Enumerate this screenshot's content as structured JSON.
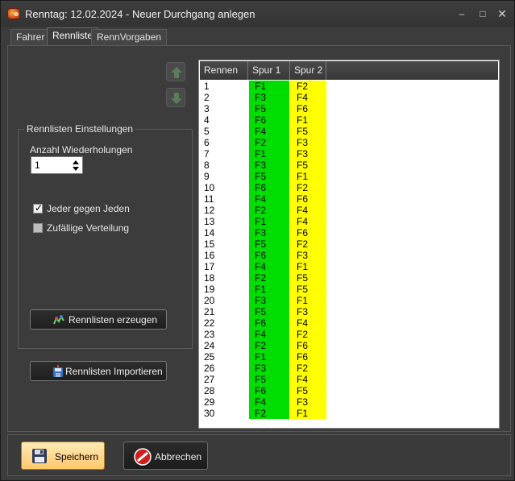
{
  "window": {
    "title": "Renntag: 12.02.2024 - Neuer Durchgang anlegen",
    "controls": {
      "minimize": "–",
      "maximize": "□",
      "close": "✕"
    }
  },
  "tabs": [
    {
      "label": "Fahrer",
      "active": false
    },
    {
      "label": "Rennliste",
      "active": true
    },
    {
      "label": "RennVorgaben",
      "active": false
    }
  ],
  "icons": {
    "move_up": "arrow-up-icon",
    "move_down": "arrow-down-icon",
    "generate": "chart-icon",
    "import": "disk-import-icon",
    "save": "floppy-disk-icon",
    "cancel": "no-entry-icon"
  },
  "settings": {
    "group_title": "Rennlisten Einstellungen",
    "repeats_label": "Anzahl Wiederholungen",
    "repeats_value": "1",
    "everyone_vs_everyone": {
      "label": "Jeder gegen Jeden",
      "checked": true
    },
    "random_distribution": {
      "label": "Zufällige Verteilung",
      "checked": false
    },
    "generate_button": "Rennlisten erzeugen"
  },
  "import_button": "Rennlisten Importieren",
  "race_list": {
    "headers": [
      "Rennen",
      "Spur 1",
      "Spur 2"
    ],
    "colors": {
      "spur1": "#00dd00",
      "spur2": "#ffff00"
    },
    "rows": [
      [
        "1",
        "F1",
        "F2"
      ],
      [
        "2",
        "F3",
        "F4"
      ],
      [
        "3",
        "F5",
        "F6"
      ],
      [
        "4",
        "F6",
        "F1"
      ],
      [
        "5",
        "F4",
        "F5"
      ],
      [
        "6",
        "F2",
        "F3"
      ],
      [
        "7",
        "F1",
        "F3"
      ],
      [
        "8",
        "F3",
        "F5"
      ],
      [
        "9",
        "F5",
        "F1"
      ],
      [
        "10",
        "F6",
        "F2"
      ],
      [
        "11",
        "F4",
        "F6"
      ],
      [
        "12",
        "F2",
        "F4"
      ],
      [
        "13",
        "F1",
        "F4"
      ],
      [
        "14",
        "F3",
        "F6"
      ],
      [
        "15",
        "F5",
        "F2"
      ],
      [
        "16",
        "F6",
        "F3"
      ],
      [
        "17",
        "F4",
        "F1"
      ],
      [
        "18",
        "F2",
        "F5"
      ],
      [
        "19",
        "F1",
        "F5"
      ],
      [
        "20",
        "F3",
        "F1"
      ],
      [
        "21",
        "F5",
        "F3"
      ],
      [
        "22",
        "F6",
        "F4"
      ],
      [
        "23",
        "F4",
        "F2"
      ],
      [
        "24",
        "F2",
        "F6"
      ],
      [
        "25",
        "F1",
        "F6"
      ],
      [
        "26",
        "F3",
        "F2"
      ],
      [
        "27",
        "F5",
        "F4"
      ],
      [
        "28",
        "F6",
        "F5"
      ],
      [
        "29",
        "F4",
        "F3"
      ],
      [
        "30",
        "F2",
        "F1"
      ]
    ]
  },
  "footer": {
    "save_button": "Speichern",
    "cancel_button": "Abbrechen"
  }
}
